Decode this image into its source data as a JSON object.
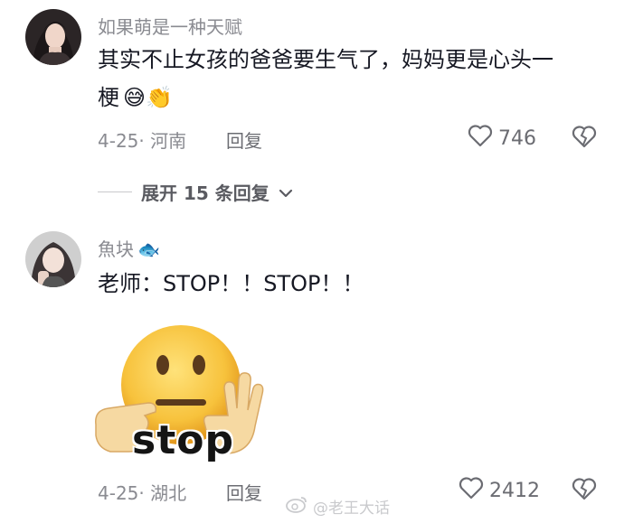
{
  "comments": [
    {
      "username": "如果萌是一种天赋",
      "text_line1": "其实不止女孩的爸爸要生气了，妈妈更是心头一",
      "text_line2": "梗",
      "emoji_1": "😅",
      "emoji_2": "👏",
      "date_location": "4-25· 河南",
      "reply_label": "回复",
      "like_count": "746"
    },
    {
      "username": "魚块",
      "username_emoji": "🐟",
      "text": "老师：STOP！！STOP！！",
      "sticker_text": "stop",
      "date_location": "4-25· 湖北",
      "reply_label": "回复",
      "like_count": "2412"
    }
  ],
  "expand_replies": {
    "label": "展开 15 条回复"
  },
  "watermark": {
    "text": "@老王大话"
  },
  "icons": {
    "like": "heart-outline-icon",
    "dislike": "broken-heart-icon",
    "chevron": "chevron-down-icon"
  },
  "colors": {
    "muted": "#8a8b91",
    "text": "#161823",
    "accent_yellow": "#f6c03a"
  }
}
